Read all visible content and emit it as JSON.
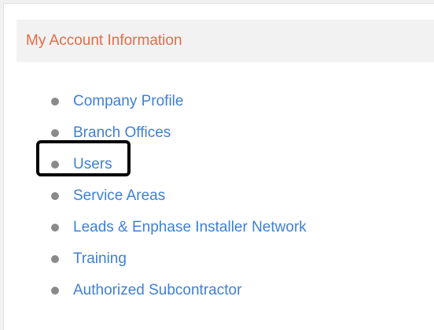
{
  "panel": {
    "title": "My Account Information"
  },
  "menu": {
    "items": [
      {
        "label": "Company Profile"
      },
      {
        "label": "Branch Offices"
      },
      {
        "label": "Users"
      },
      {
        "label": "Service Areas"
      },
      {
        "label": "Leads & Enphase Installer Network"
      },
      {
        "label": "Training"
      },
      {
        "label": "Authorized Subcontractor"
      }
    ]
  },
  "colors": {
    "title": "#e36c4a",
    "link": "#3f7fd6",
    "bullet": "#8a8a8a",
    "header_bg": "#f2f2f2",
    "highlight": "#000000"
  }
}
